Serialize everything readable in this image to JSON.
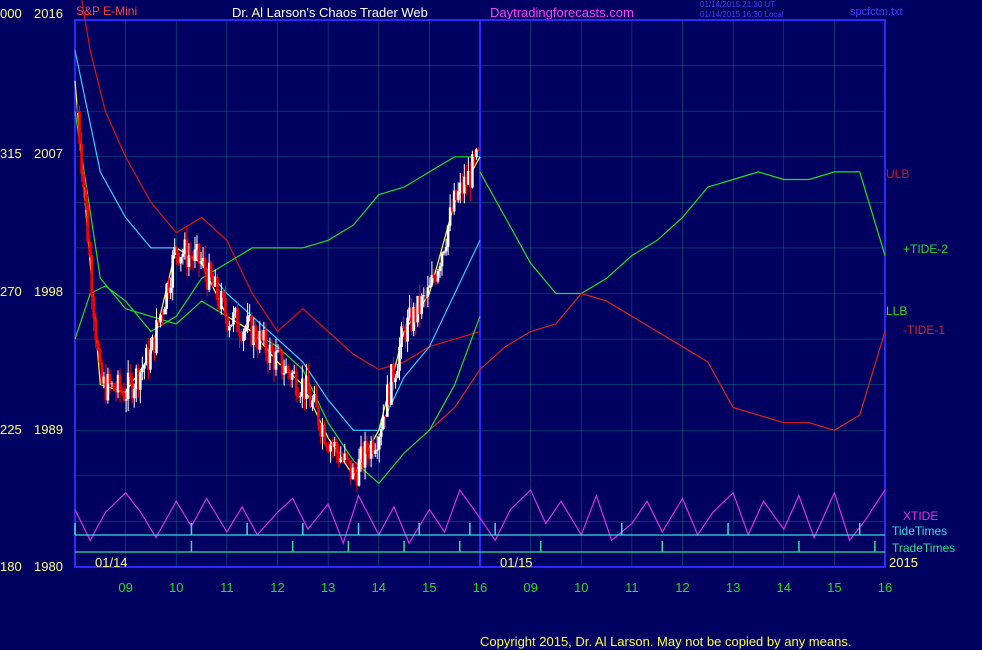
{
  "header": {
    "instrument": "S&P E-Mini",
    "title": "Dr. Al Larson's Chaos Trader Web",
    "site": "Daytradingforecasts.com",
    "time_line_1": "01/14/2015 21:30 UT",
    "time_line_2": "01/14/2015 16:30 Local",
    "file": "spcfctm.txt"
  },
  "footer": {
    "copyright": "Copyright 2015, Dr. Al Larson. May not be copied by any means.",
    "year": "2015"
  },
  "colors": {
    "background": "#000060",
    "grid": "#00808a",
    "frame": "#2a2aff",
    "price_up": "#ffffff",
    "price_down": "#ff0000",
    "ulb": "#e01010",
    "llb": "#20e020",
    "tide_plus": "#20e020",
    "tide_minus": "#e02020",
    "xtide": "#e030e0",
    "tide_times": "#30e0e0",
    "trade_times": "#30e090",
    "ema_fast": "#ffff40",
    "ema_mid": "#30d0ff",
    "ema_slow": "#20e020"
  },
  "chart_data": {
    "type": "line",
    "title": "S&P E-Mini",
    "xlabel": "",
    "ylabel": "",
    "ylim": [
      1980,
      2016
    ],
    "grid": true,
    "y_ticks_left": [
      "000",
      "315",
      "270",
      "225",
      "180"
    ],
    "y_ticks_right": [
      "2016",
      "2007",
      "1998",
      "1989",
      "1980"
    ],
    "date_labels": [
      "01/14",
      "01/15"
    ],
    "x_ticks": [
      "09",
      "10",
      "11",
      "12",
      "13",
      "14",
      "15",
      "16",
      "09",
      "10",
      "11",
      "12",
      "13",
      "14",
      "15",
      "16"
    ],
    "x_range_hours": [
      8.0,
      24.0
    ],
    "series_labels": {
      "ulb": "ULB",
      "tide2": "+TIDE-2",
      "llb": "LLB",
      "tide1": "-TIDE-1",
      "xtide": "XTIDE",
      "tidetimes": "TideTimes",
      "tradetimes": "TradeTimes"
    },
    "ulb": {
      "x": [
        8.0,
        8.3,
        8.6,
        9.0,
        9.5,
        10.0,
        10.5,
        11.0,
        11.5,
        12.0,
        12.5,
        13.0,
        13.5,
        14.0,
        14.5,
        15.0,
        15.5,
        16.0
      ],
      "y": [
        2020.0,
        2014.0,
        2010.0,
        2007.0,
        2004.0,
        2002.0,
        2003.0,
        2001.5,
        1998.0,
        1995.5,
        1997.0,
        1995.5,
        1994.0,
        1993.0,
        1993.5,
        1994.5,
        1995.0,
        1995.5
      ]
    },
    "llb": {
      "x": [
        8.0,
        8.3,
        8.6,
        9.0,
        9.5,
        10.0,
        10.5,
        11.0,
        11.5,
        12.0,
        12.5,
        13.0,
        13.5,
        14.0,
        14.5,
        15.0,
        15.5,
        16.0
      ],
      "y": [
        1995.0,
        1998.0,
        1998.5,
        1997.5,
        1995.5,
        1996.5,
        1999.0,
        2000.0,
        2001.0,
        2001.0,
        2001.0,
        2001.5,
        2002.5,
        2004.5,
        2005.0,
        2006.0,
        2007.0,
        2007.0
      ]
    },
    "tide2": {
      "x": [
        16.0,
        16.5,
        17.0,
        17.5,
        18.0,
        18.5,
        19.0,
        19.5,
        20.0,
        20.5,
        21.0,
        21.5,
        22.0,
        22.5,
        23.0,
        23.5,
        24.0
      ],
      "y": [
        2006.0,
        2003.0,
        2000.0,
        1998.0,
        1998.0,
        1999.0,
        2000.5,
        2001.5,
        2003.0,
        2005.0,
        2005.5,
        2006.0,
        2005.5,
        2005.5,
        2006.0,
        2006.0,
        2000.5
      ]
    },
    "tide1": {
      "x": [
        15.0,
        15.5,
        16.0,
        16.5,
        17.0,
        17.5,
        18.0,
        18.5,
        19.0,
        19.5,
        20.0,
        20.5,
        21.0,
        21.5,
        22.0,
        22.5,
        23.0,
        23.5,
        24.0
      ],
      "y": [
        1989.0,
        1990.5,
        1993.0,
        1994.5,
        1995.5,
        1996.0,
        1998.0,
        1997.5,
        1996.5,
        1995.5,
        1994.5,
        1993.5,
        1990.5,
        1990.0,
        1989.5,
        1989.5,
        1989.0,
        1990.0,
        1995.5
      ]
    },
    "ema_fast": {
      "x": [
        8.0,
        8.5,
        9.0,
        9.5,
        10.0,
        10.5,
        11.0,
        11.5,
        12.0,
        12.5,
        13.0,
        13.5,
        14.0,
        14.5,
        15.0,
        15.5,
        16.0
      ],
      "y": [
        2012.0,
        1992.0,
        1991.5,
        1994.0,
        2001.0,
        2000.0,
        1996.5,
        1995.5,
        1993.5,
        1992.0,
        1988.5,
        1986.0,
        1989.0,
        1995.5,
        1998.0,
        2004.0,
        2007.0
      ]
    },
    "ema_mid": {
      "x": [
        8.0,
        8.5,
        9.0,
        9.5,
        10.0,
        10.5,
        11.0,
        11.5,
        12.0,
        12.5,
        13.0,
        13.5,
        14.0,
        14.5,
        15.0,
        15.5,
        16.0
      ],
      "y": [
        2014.0,
        2006.0,
        2003.0,
        2001.0,
        2001.0,
        2000.0,
        1998.0,
        1996.5,
        1995.0,
        1993.5,
        1991.0,
        1989.0,
        1989.0,
        1992.5,
        1994.5,
        1998.0,
        2001.5
      ]
    },
    "ema_slow": {
      "x": [
        8.0,
        8.5,
        9.0,
        9.5,
        10.0,
        10.5,
        11.0,
        11.5,
        12.0,
        12.5,
        13.0,
        13.5,
        14.0,
        14.5,
        15.0,
        15.5,
        16.0
      ],
      "y": [
        2010.0,
        1999.0,
        1997.0,
        1996.5,
        1996.0,
        1997.5,
        1996.5,
        1995.5,
        1994.5,
        1993.0,
        1989.5,
        1987.0,
        1985.5,
        1987.5,
        1989.0,
        1992.0,
        1996.5
      ]
    },
    "xtide": {
      "x": [
        8.0,
        8.3,
        8.6,
        9.0,
        9.3,
        9.6,
        10.0,
        10.3,
        10.6,
        11.0,
        11.3,
        11.6,
        12.0,
        12.3,
        12.6,
        13.0,
        13.3,
        13.6,
        14.0,
        14.3,
        14.6,
        15.0,
        15.3,
        15.6,
        16.0,
        16.3,
        16.6,
        17.0,
        17.3,
        17.6,
        18.0,
        18.3,
        18.6,
        19.0,
        19.3,
        19.6,
        20.0,
        20.3,
        20.6,
        21.0,
        21.3,
        21.6,
        22.0,
        22.3,
        22.6,
        23.0,
        23.3,
        23.6,
        24.0
      ],
      "y": [
        0.3,
        -0.8,
        0.2,
        0.9,
        0.2,
        -0.7,
        0.6,
        -0.3,
        0.7,
        -0.5,
        0.4,
        -0.6,
        0.2,
        0.7,
        -0.4,
        0.5,
        -0.9,
        0.8,
        -0.6,
        0.4,
        -0.9,
        0.3,
        -0.5,
        1.0,
        0.0,
        -0.8,
        0.3,
        1.0,
        -0.2,
        0.6,
        -0.6,
        0.8,
        -0.8,
        -0.2,
        0.6,
        -0.5,
        0.7,
        -0.6,
        0.2,
        0.9,
        -0.6,
        0.6,
        -0.4,
        0.8,
        -0.7,
        0.9,
        -0.8,
        -0.1,
        1.0
      ]
    },
    "tide_times_x": [
      8.0,
      10.3,
      11.4,
      12.5,
      13.6,
      14.8,
      15.8,
      16.3,
      18.8,
      20.9,
      23.5
    ],
    "trade_times_x": [
      10.3,
      12.3,
      13.4,
      14.5,
      15.6,
      17.2,
      19.6,
      22.3,
      23.8
    ]
  }
}
